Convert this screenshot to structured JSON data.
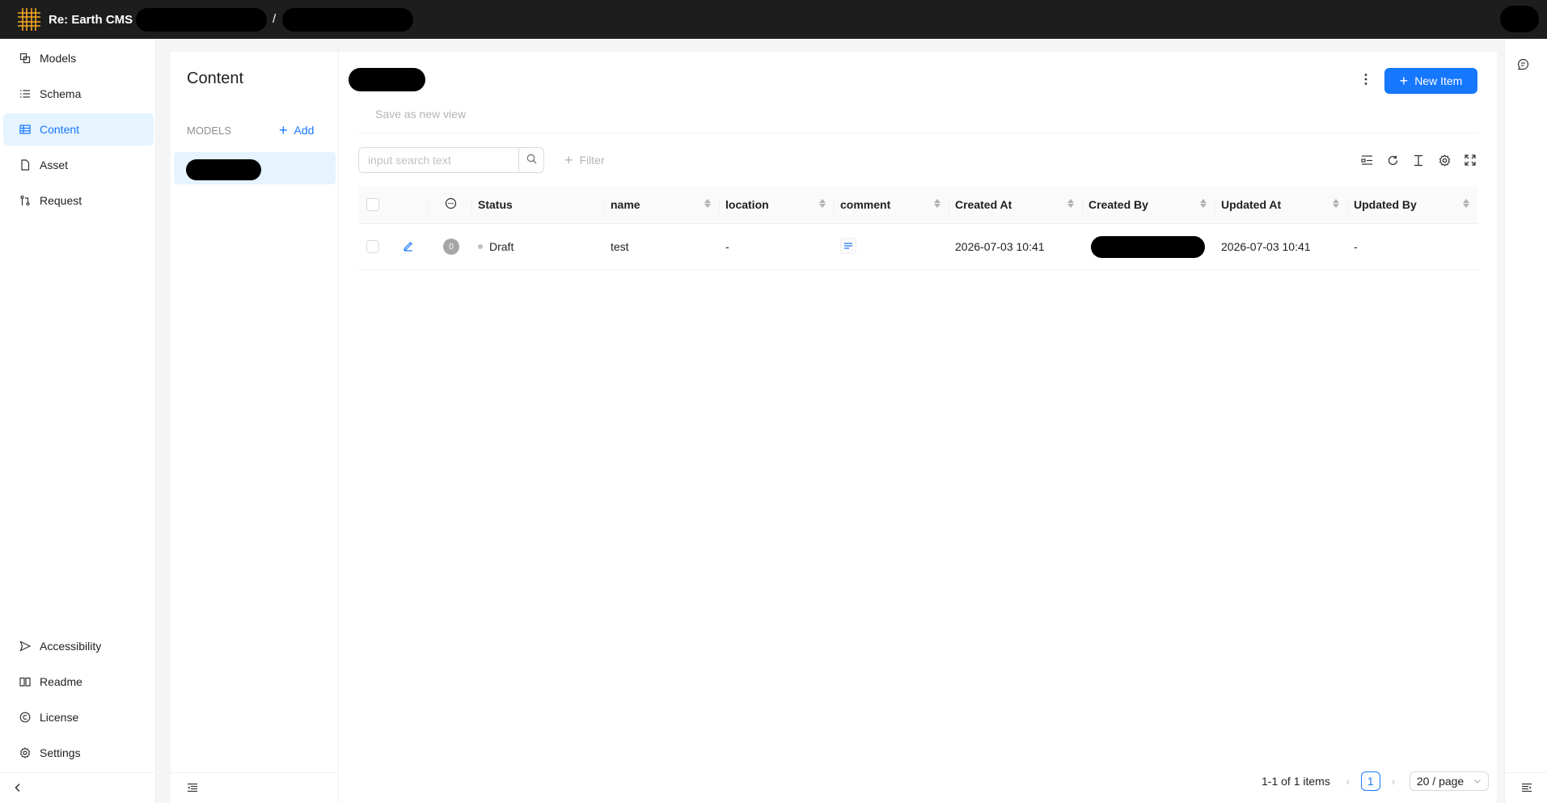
{
  "header": {
    "app_title": "Re: Earth CMS",
    "breadcrumb_separator": "/"
  },
  "sidebar": {
    "items": [
      {
        "label": "Models",
        "icon": "models-icon"
      },
      {
        "label": "Schema",
        "icon": "schema-icon"
      },
      {
        "label": "Content",
        "icon": "content-icon",
        "active": true
      },
      {
        "label": "Asset",
        "icon": "asset-icon"
      },
      {
        "label": "Request",
        "icon": "request-icon"
      }
    ],
    "bottom_items": [
      {
        "label": "Accessibility",
        "icon": "accessibility-icon"
      },
      {
        "label": "Readme",
        "icon": "readme-icon"
      },
      {
        "label": "License",
        "icon": "license-icon"
      },
      {
        "label": "Settings",
        "icon": "settings-icon"
      }
    ]
  },
  "models_panel": {
    "title": "Content",
    "section_label": "MODELS",
    "add_label": "Add"
  },
  "main": {
    "new_item_label": "New Item",
    "save_view_label": "Save as new view",
    "search_placeholder": "input search text",
    "filter_label": "Filter",
    "columns": [
      "Status",
      "name",
      "location",
      "comment",
      "Created At",
      "Created By",
      "Updated At",
      "Updated By"
    ],
    "rows": [
      {
        "comment_count": "0",
        "status": "Draft",
        "name": "test",
        "location": "-",
        "created_at": "2026-07-03 10:41",
        "updated_at": "2026-07-03 10:41",
        "updated_by": "-"
      }
    ],
    "pagination": {
      "summary": "1-1 of 1 items",
      "current_page": "1",
      "page_size": "20 / page"
    }
  },
  "colors": {
    "primary": "#1677ff",
    "header_bg": "#1d1d1d",
    "active_bg": "#e6f4ff",
    "logo": "#f5a623"
  }
}
